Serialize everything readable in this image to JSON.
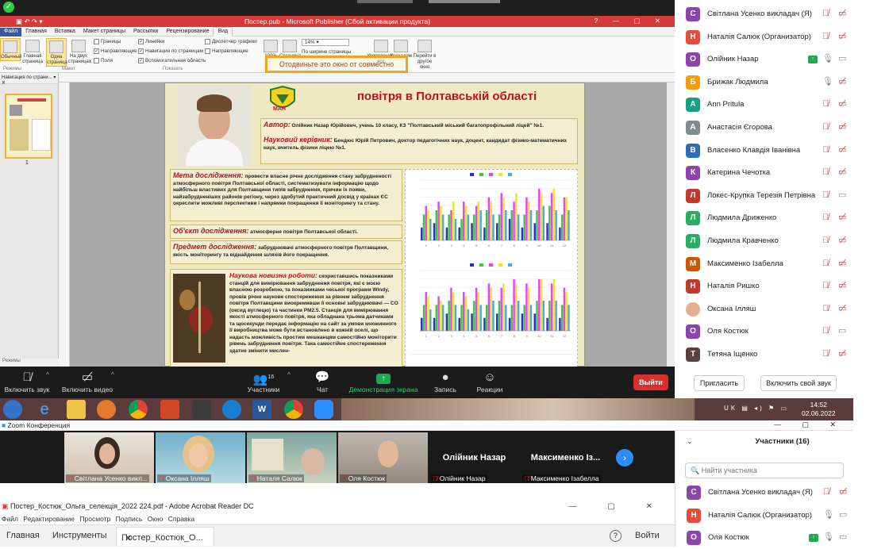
{
  "publisher": {
    "window_title": "Постер.pub - Microsoft Publisher (Сбой активации продукта)",
    "tabs": [
      "Файл",
      "Главная",
      "Вставка",
      "Макет страницы",
      "Рассылки",
      "Рецензирование",
      "Вид"
    ],
    "ribbon": {
      "views": [
        "Обычный",
        "Главная страница",
        "Одна страница",
        "На двух страницах"
      ],
      "checks_col1": [
        "Границы",
        "Направляющие",
        "Поля"
      ],
      "checks_col2": [
        "Линейки",
        "Навигация по страницам",
        "Вспомогательная область"
      ],
      "checks_col3": [
        "Диспетчер графики",
        "Направляющие"
      ],
      "zoom_value": "14%",
      "zoom_items": [
        "100%",
        "Страница",
        "По ширине страницы",
        "Выделенные объекты"
      ],
      "other_items": [
        "Упорядочить все",
        "Каскадом",
        "Перейти в другое окно"
      ],
      "groups": [
        "Режимы",
        "Макет",
        "Показать",
        "Масштаб",
        "Окно"
      ]
    },
    "share_overlay_text": "Отодвиньте это окно от совместно",
    "left_pane_title": "Навигация по страни...",
    "page_number": "1"
  },
  "poster": {
    "title": "повітря в Полтавській області",
    "logo_text": "МАН",
    "author_label": "Автор:",
    "author_text": "Олійник Назар Юрійович, учень 10 класу, КЗ \"Полтавський міський багатопрофільний ліцей\" №1.",
    "supervisor_label": "Науковий керівник:",
    "supervisor_text": "Бендюс Юрій Петрович, доктор педагогічних наук, доцент, кандидат фізико-математичних наук, вчитель фізики ліцею №1.",
    "goal_label": "Мета дослідження:",
    "goal_text": "провести власне річне дослідження стану забрудненості атмосферного повітря Полтавської області, систематизувати інформацію щодо найбільш властивих для Полтавщини типів забруднення, причин їх появи, найзабрудненіших районів регіону, через здобутий практичний досвід у країнах ЄС окреслити можливі перспективи і напрямки покращення її моніторингу та стану.",
    "object_label": "Об'єкт дослідження:",
    "object_text": "атмосферне повітря Полтавської області.",
    "subject_label": "Предмет дослідження:",
    "subject_text": "забруднювачі атмосферного повітря Полтавщини, якість моніторингу та віднайдення шляхів його покращення.",
    "novelty_label": "Наукова новизна роботи:",
    "novelty_text": "скориставшись показниками станцій для вимірювання забруднення повітря, які є моєю власною розробкою, та показниками чеської програми Windy, провів річне наукове спостереження за рівнем забруднення повітря Полтавщини виокремивши її основні забруднювачі — CO (оксид вуглецю) та частинки PM2.5. Станція для вимірювання якості атмосферного повітря, яка обладнана трьома датчиками та щосекунди передає інформацію на сайт за умови множинного її виробництва може бути встановлено в кожній оселі, що надасть можливість простим мешканцям самостійно моніторити рівень забруднення повітря. Така самостійне спостереження здатне змінити мислен-"
  },
  "chart_data": [
    {
      "type": "bar",
      "title": "",
      "categories": [
        "1",
        "2",
        "3",
        "4",
        "5",
        "6",
        "7",
        "8",
        "9",
        "10",
        "11",
        "12"
      ],
      "series": [
        {
          "values": [
            3,
            4,
            3,
            3,
            4,
            3,
            4,
            5,
            3,
            4,
            4,
            3
          ]
        },
        {
          "values": [
            6,
            7,
            6,
            5,
            6,
            7,
            6,
            7,
            6,
            7,
            8,
            6
          ]
        },
        {
          "values": [
            8,
            9,
            7,
            9,
            8,
            10,
            11,
            9,
            10,
            12,
            11,
            10
          ]
        },
        {
          "values": [
            7,
            8,
            9,
            8,
            9,
            9,
            10,
            11,
            9,
            11,
            12,
            10
          ]
        },
        {
          "values": [
            5,
            6,
            5,
            6,
            7,
            6,
            7,
            6,
            7,
            8,
            7,
            7
          ]
        }
      ],
      "colors": [
        "#2f2fbf",
        "#3fc63f",
        "#f040f0",
        "#e8e82a",
        "#4aa8e8"
      ]
    },
    {
      "type": "bar",
      "title": "",
      "categories": [
        "1",
        "2",
        "3",
        "4",
        "5",
        "6",
        "7",
        "8",
        "9",
        "10",
        "11",
        "12"
      ],
      "series": [
        {
          "values": [
            3,
            3,
            4,
            3,
            4,
            3,
            4,
            3,
            4,
            4,
            3,
            3
          ]
        },
        {
          "values": [
            6,
            6,
            7,
            6,
            7,
            6,
            7,
            6,
            6,
            7,
            7,
            6
          ]
        },
        {
          "values": [
            9,
            8,
            10,
            9,
            10,
            11,
            10,
            12,
            11,
            12,
            11,
            10
          ]
        },
        {
          "values": [
            8,
            7,
            9,
            8,
            9,
            10,
            11,
            11,
            10,
            12,
            12,
            9
          ]
        },
        {
          "values": [
            5,
            6,
            6,
            5,
            6,
            7,
            6,
            7,
            6,
            7,
            7,
            6
          ]
        }
      ],
      "colors": [
        "#2f2fbf",
        "#3fc63f",
        "#f040f0",
        "#e8e82a",
        "#4aa8e8"
      ]
    }
  ],
  "zoom_toolbar": {
    "mute": "Включить звук",
    "video": "Включить видео",
    "participants": "Участники",
    "participants_count": "16",
    "chat": "Чат",
    "share": "Демонстрация экрана",
    "record": "Запись",
    "reactions": "Реакции",
    "end": "Выйти"
  },
  "participants": [
    {
      "initial": "С",
      "name": "Світлана Усенко викладач (Я)",
      "color": "#8e44ad"
    },
    {
      "initial": "Н",
      "name": "Наталія Салюк (Организатор)",
      "color": "#e74c3c"
    },
    {
      "initial": "О",
      "name": "Олійник Назар",
      "color": "#8e44ad"
    },
    {
      "initial": "Б",
      "name": "Брижак Людмила",
      "color": "#f39c12"
    },
    {
      "initial": "A",
      "name": "Ann Pritula",
      "color": "#16a085"
    },
    {
      "initial": "А",
      "name": "Анастасія Єгорова",
      "color": "#7f8c8d"
    },
    {
      "initial": "В",
      "name": "Власенко Клавдія Іванівна",
      "color": "#2c6fb7"
    },
    {
      "initial": "К",
      "name": "Катерина Чечотка",
      "color": "#8e44ad"
    },
    {
      "initial": "Л",
      "name": "Локес-Крупка Терезія Петрівна",
      "color": "#c0392b"
    },
    {
      "initial": "Л",
      "name": "Людмила Дриженко",
      "color": "#27ae60"
    },
    {
      "initial": "Л",
      "name": "Людмила Кравченко",
      "color": "#27ae60"
    },
    {
      "initial": "М",
      "name": "Максименко Ізабелла",
      "color": "#d35400"
    },
    {
      "initial": "Н",
      "name": "Наталія Ришко",
      "color": "#c0392b"
    },
    {
      "initial": "",
      "name": "Оксана Ілляш",
      "color": "#e0b090"
    },
    {
      "initial": "О",
      "name": "Оля Костюк",
      "color": "#8e44ad"
    },
    {
      "initial": "Т",
      "name": "Тетяна Іщенко",
      "color": "#5d4037"
    }
  ],
  "panel_buttons": {
    "invite": "Пригласить",
    "unmute": "Включить свой звук"
  },
  "taskbar": {
    "lang": "UK",
    "time": "14:52",
    "date": "02.06.2022"
  },
  "zoom_window": {
    "title": "Zoom Конференция"
  },
  "gallery": [
    {
      "name": "Світлана Усенко викл..."
    },
    {
      "name": "Оксана Ілляш"
    },
    {
      "name": "Наталя Салюк"
    },
    {
      "name": "Оля Костюк"
    },
    {
      "name": "Олійник Назар",
      "big": "Олійник Назар"
    },
    {
      "name": "Максименко Ізабелла",
      "big": "Максименко Із..."
    }
  ],
  "panel2": {
    "header": "Участники (16)",
    "search_placeholder": "Найти участника",
    "rows": [
      {
        "initial": "С",
        "name": "Світлана Усенко викладач (Я)",
        "color": "#8e44ad"
      },
      {
        "initial": "Н",
        "name": "Наталія Салюк (Организатор)",
        "color": "#e74c3c"
      },
      {
        "initial": "О",
        "name": "Оля Костюк",
        "color": "#8e44ad"
      }
    ]
  },
  "acrobat": {
    "title": "Постер_Костюк_Ольга_селекція_2022 224.pdf - Adobe Acrobat Reader DC",
    "menu": [
      "Файл",
      "Редактирование",
      "Просмотр",
      "Подпись",
      "Окно",
      "Справка"
    ],
    "tab_home": "Главная",
    "tab_tools": "Инструменты",
    "tab_doc": "Постер_Костюк_О...",
    "login": "Войти"
  }
}
